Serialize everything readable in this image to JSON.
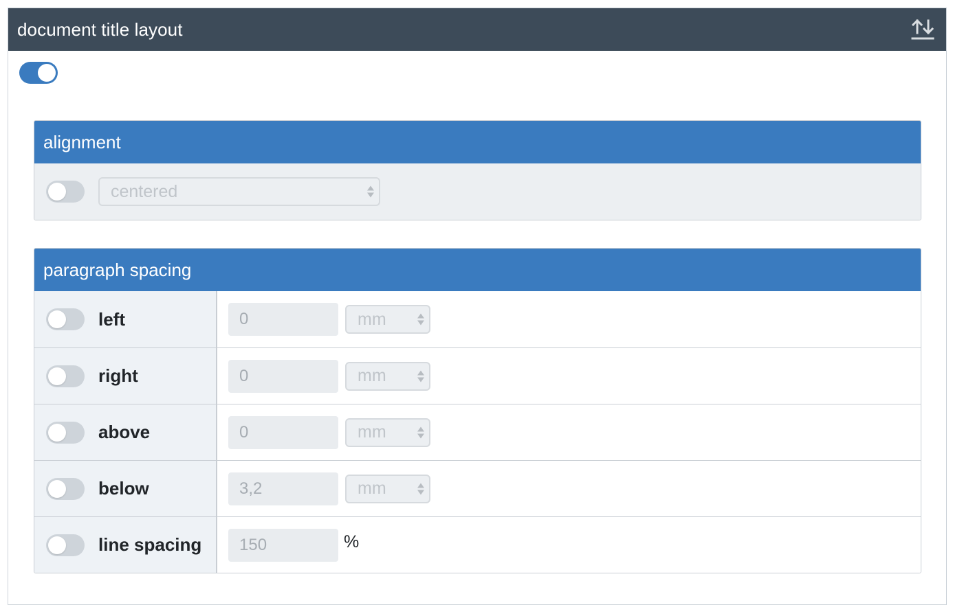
{
  "header": {
    "title": "document title layout",
    "sort_icon": "sort-up-down-icon"
  },
  "master_toggle": {
    "on": true
  },
  "alignment": {
    "title": "alignment",
    "toggle_on": false,
    "select_value": "centered"
  },
  "paragraph_spacing": {
    "title": "paragraph spacing",
    "rows": [
      {
        "label": "left",
        "value": "0",
        "unit": "mm"
      },
      {
        "label": "right",
        "value": "0",
        "unit": "mm"
      },
      {
        "label": "above",
        "value": "0",
        "unit": "mm"
      },
      {
        "label": "below",
        "value": "3,2",
        "unit": "mm"
      },
      {
        "label": "line spacing",
        "value": "150",
        "unit": "%"
      }
    ]
  },
  "colors": {
    "header_bg": "#3d4b59",
    "panel_header_bg": "#3a7bbf",
    "toggle_on": "#3a7bbf",
    "toggle_off": "#ced4da"
  }
}
